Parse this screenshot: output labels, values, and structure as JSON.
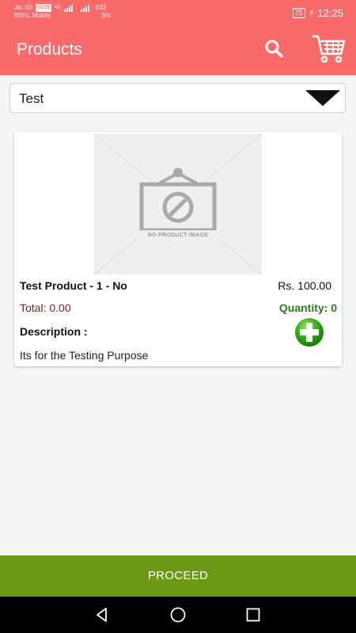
{
  "status_bar": {
    "carrier_line1": "Jio 4G",
    "network_badge": "VoLTE",
    "carrier_line2": "BSNL Mobile",
    "net_type": "4G",
    "speed_value": "632",
    "speed_unit": "B/s",
    "battery": "75",
    "time": "12:25"
  },
  "app_bar": {
    "title": "Products",
    "search_icon": "search-icon",
    "cart_icon": "cart-icon"
  },
  "category_dropdown": {
    "selected": "Test"
  },
  "product": {
    "image_text": "NO PRODUCT IMAGE",
    "name": "Test Product - 1 - No",
    "price": "Rs. 100.00",
    "total": "Total: 0.00",
    "quantity": "Quantity: 0",
    "description_label": "Description :",
    "description": "Its for the Testing Purpose"
  },
  "proceed_label": "PROCEED",
  "colors": {
    "accent": "#fb6a6a",
    "proceed": "#6a9a12",
    "quantity_text": "#2c7d12",
    "total_text": "#7a1f1f"
  }
}
